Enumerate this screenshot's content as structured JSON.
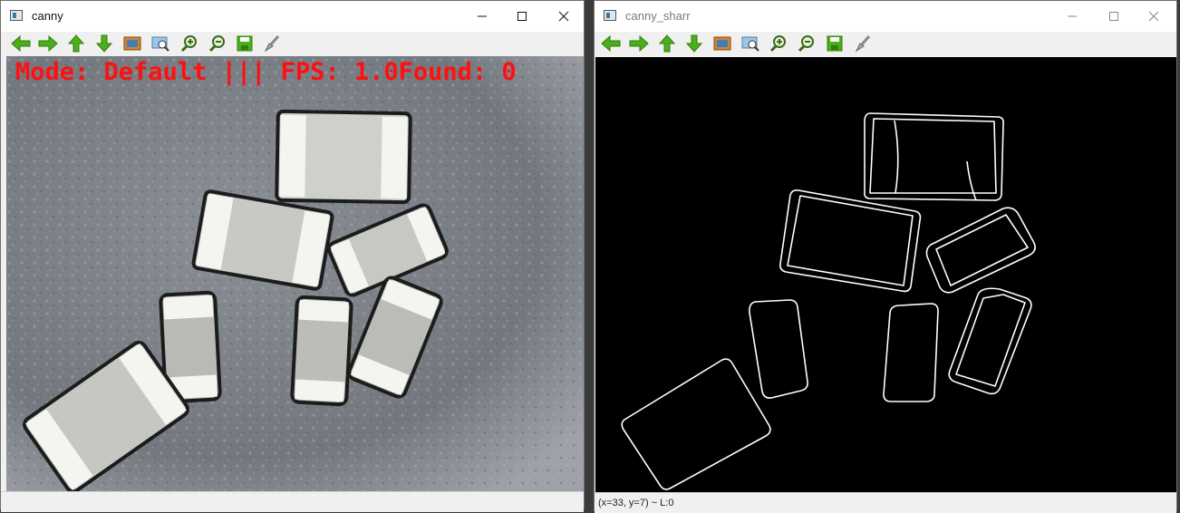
{
  "windows": {
    "left": {
      "title": "canny",
      "overlay_text": "Mode: Default ||| FPS: 1.0Found: 0"
    },
    "right": {
      "title": "canny_sharr",
      "status_text": "(x=33, y=7) ~ L:0"
    }
  },
  "toolbar": {
    "icons": [
      "arrow-left-icon",
      "arrow-right-icon",
      "arrow-up-icon",
      "arrow-down-icon",
      "image-icon",
      "zoom-fit-icon",
      "zoom-in-icon",
      "zoom-out-icon",
      "save-icon",
      "brush-icon"
    ]
  },
  "colors": {
    "toolbar_green": "#4caf1a",
    "overlay_red": "#ff1010"
  }
}
